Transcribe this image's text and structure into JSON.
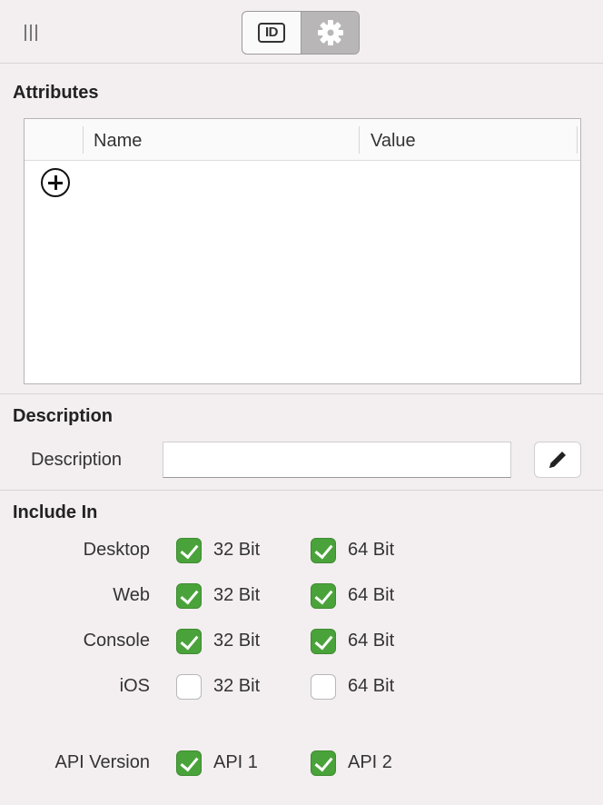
{
  "toolbar": {
    "tabs": [
      {
        "label": "ID",
        "icon": "id-icon",
        "active": false
      },
      {
        "label": "",
        "icon": "gear-icon",
        "active": true
      }
    ]
  },
  "attributes": {
    "title": "Attributes",
    "columns": [
      "Name",
      "Value"
    ],
    "rows": []
  },
  "description": {
    "title": "Description",
    "label": "Description",
    "value": "",
    "edit_icon": "pencil-icon"
  },
  "include_in": {
    "title": "Include In",
    "rows": [
      {
        "label": "Desktop",
        "options": [
          {
            "label": "32 Bit",
            "checked": true
          },
          {
            "label": "64 Bit",
            "checked": true
          }
        ]
      },
      {
        "label": "Web",
        "options": [
          {
            "label": "32 Bit",
            "checked": true
          },
          {
            "label": "64 Bit",
            "checked": true
          }
        ]
      },
      {
        "label": "Console",
        "options": [
          {
            "label": "32 Bit",
            "checked": true
          },
          {
            "label": "64 Bit",
            "checked": true
          }
        ]
      },
      {
        "label": "iOS",
        "options": [
          {
            "label": "32 Bit",
            "checked": false
          },
          {
            "label": "64 Bit",
            "checked": false
          }
        ]
      }
    ],
    "api": {
      "label": "API Version",
      "options": [
        {
          "label": "API 1",
          "checked": true
        },
        {
          "label": "API 2",
          "checked": true
        }
      ]
    }
  },
  "colors": {
    "check_green": "#4aa33a",
    "background": "#f3eef0"
  }
}
